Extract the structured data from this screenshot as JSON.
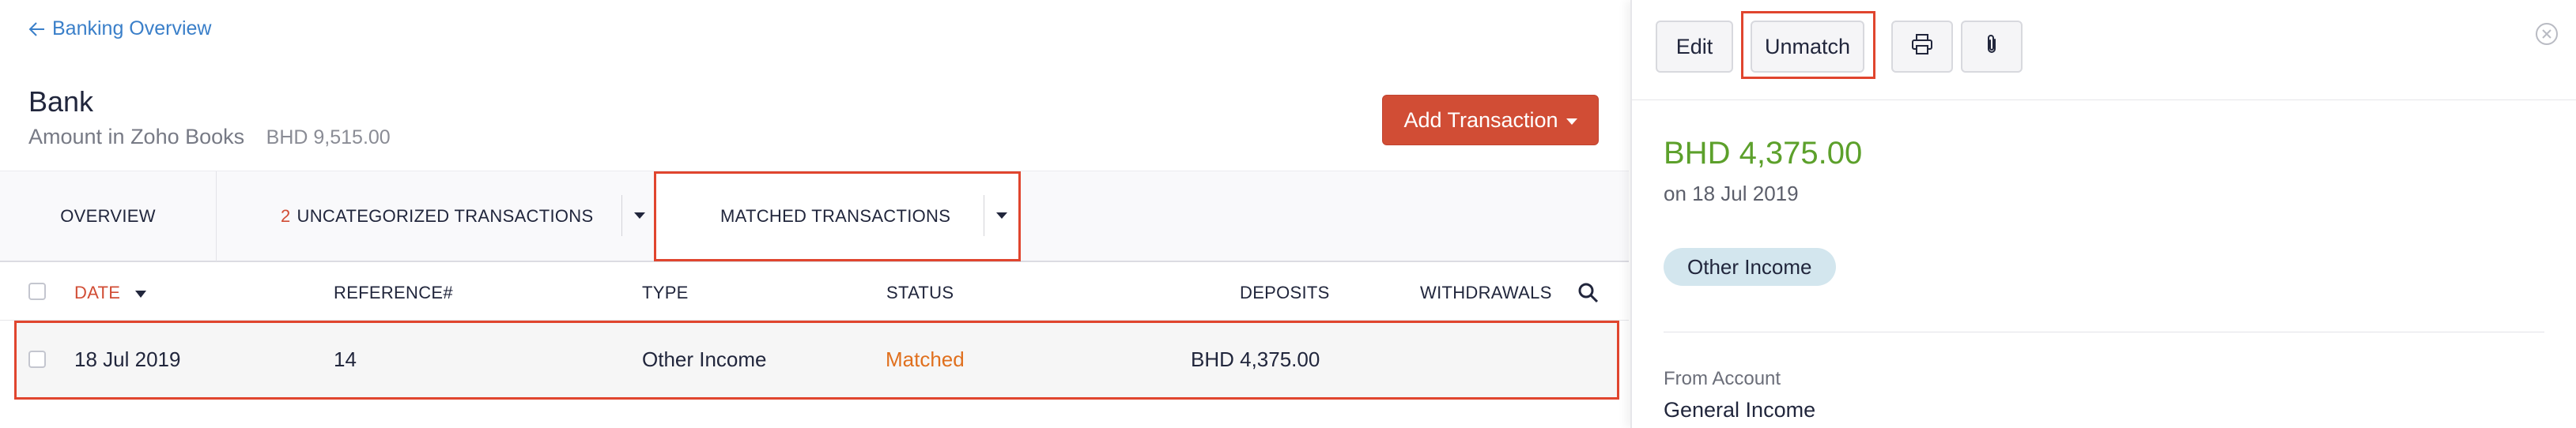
{
  "header": {
    "back_link": "Banking Overview",
    "bank_name": "Bank",
    "amount_label": "Amount in Zoho Books",
    "amount_value": "BHD 9,515.00",
    "add_button": "Add Transaction"
  },
  "tabs": {
    "overview": "OVERVIEW",
    "uncategorized_count": "2",
    "uncategorized_label": "UNCATEGORIZED TRANSACTIONS",
    "matched": "MATCHED TRANSACTIONS"
  },
  "table": {
    "columns": {
      "date": "DATE",
      "reference": "REFERENCE#",
      "type": "TYPE",
      "status": "STATUS",
      "deposits": "DEPOSITS",
      "withdrawals": "WITHDRAWALS"
    },
    "rows": [
      {
        "date": "18 Jul 2019",
        "reference": "14",
        "type": "Other Income",
        "status": "Matched",
        "deposits": "BHD 4,375.00",
        "withdrawals": ""
      }
    ]
  },
  "detail": {
    "toolbar": {
      "edit": "Edit",
      "unmatch": "Unmatch"
    },
    "amount": "BHD 4,375.00",
    "date": "on 18 Jul 2019",
    "badge": "Other Income",
    "from_label": "From Account",
    "from_value": "General Income"
  },
  "colors": {
    "accent_red": "#d14d35",
    "link_blue": "#3a7fc9",
    "status_orange": "#e0701e",
    "amount_green": "#5ca02b",
    "badge_bg": "#d3e6ee",
    "highlight_outline": "#e0452e"
  },
  "icons": {
    "back": "arrow-left-icon",
    "sort": "sort-desc-icon",
    "search": "search-icon",
    "print": "printer-icon",
    "attach": "paperclip-icon",
    "close": "close-icon"
  }
}
